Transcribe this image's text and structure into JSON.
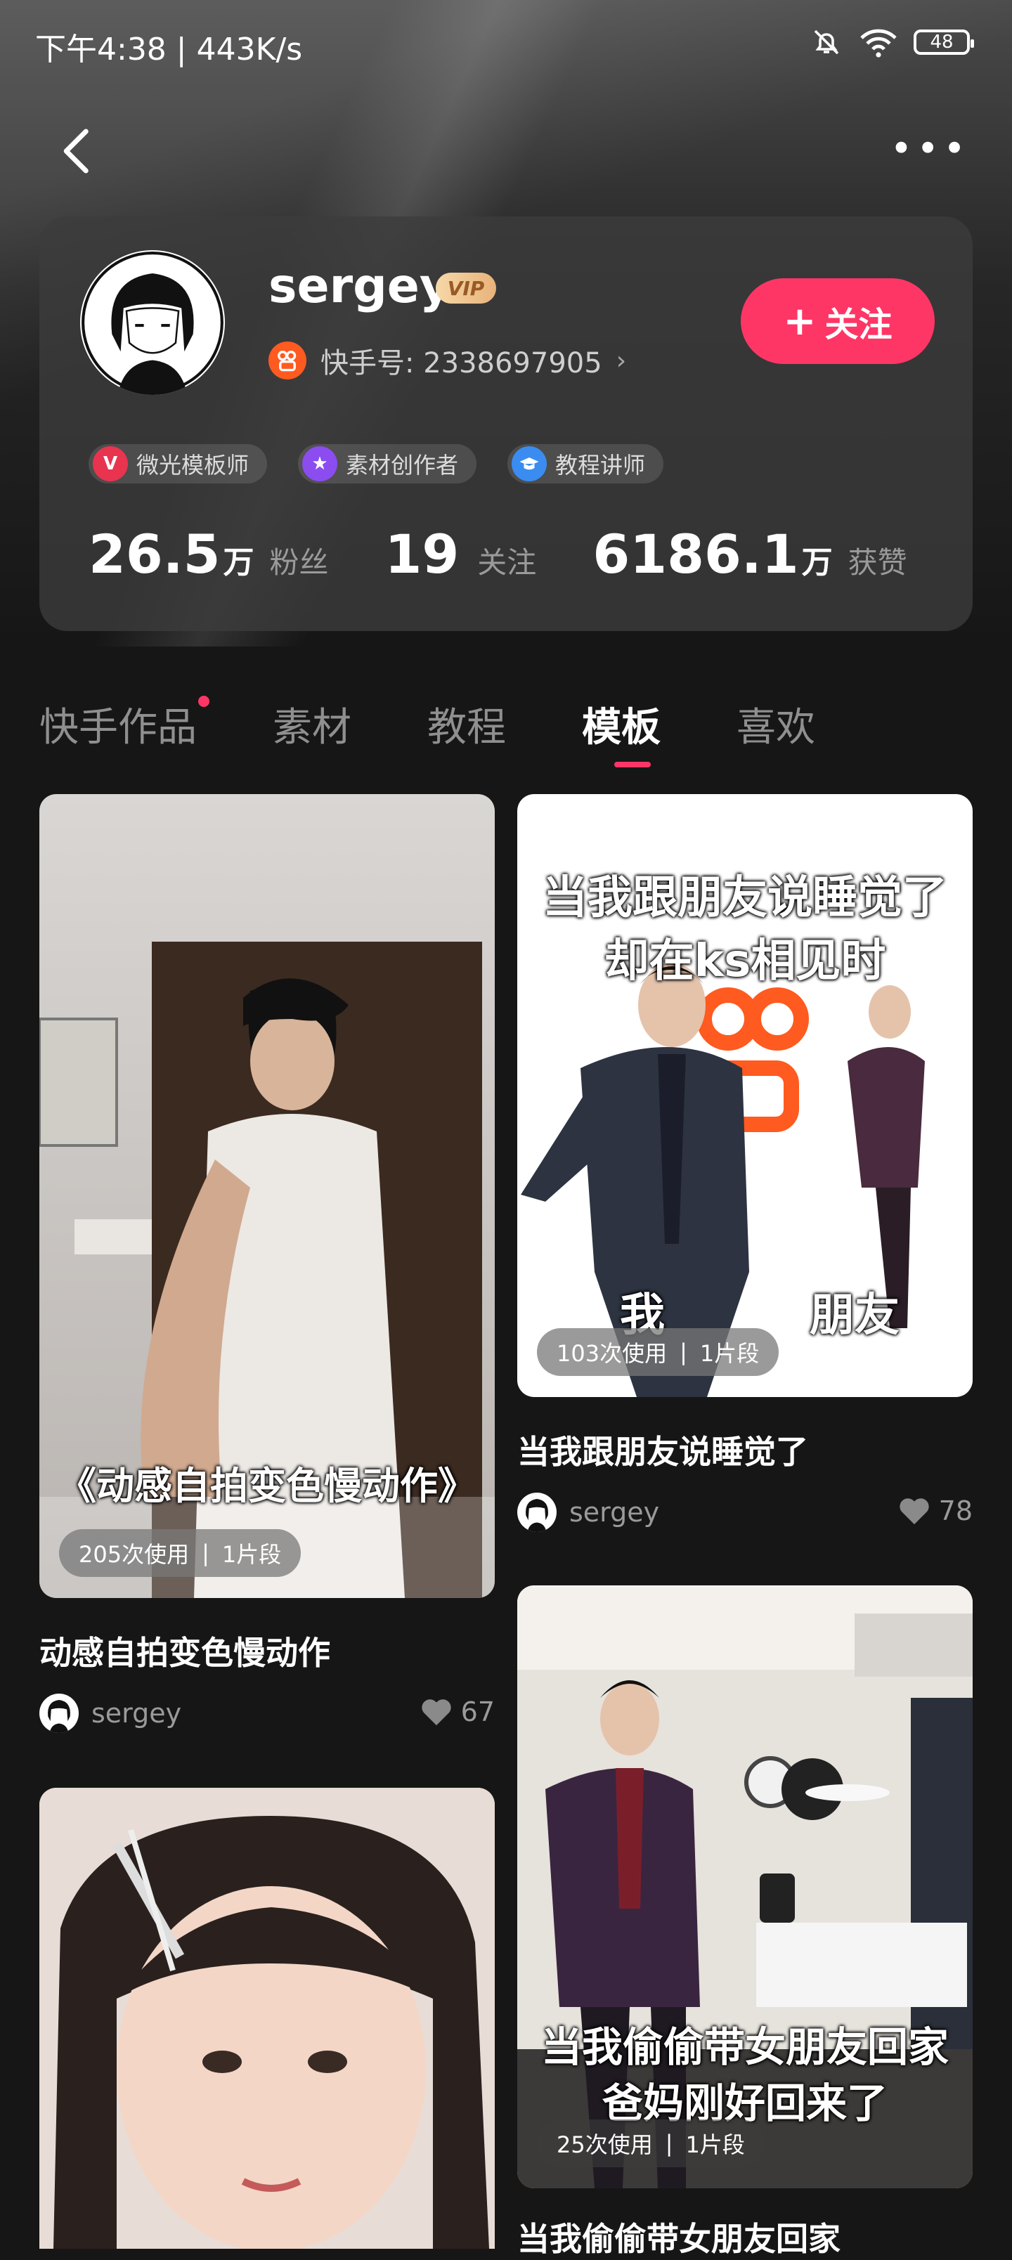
{
  "status": {
    "time_speed": "下午4:38 | 443K/s",
    "battery": "48"
  },
  "profile": {
    "username": "sergey",
    "vip": "VIP",
    "kuaishou_id": "快手号: 2338697905",
    "follow_label": "关注",
    "badges": [
      {
        "label": "微光模板师",
        "icon": "V",
        "color": "#e8344f"
      },
      {
        "label": "素材创作者",
        "icon": "★",
        "color": "#8b4cf0"
      },
      {
        "label": "教程讲师",
        "icon": "🎓",
        "color": "#3a8cf0"
      }
    ],
    "stats": [
      {
        "num": "26.5",
        "unit": "万",
        "label": "粉丝"
      },
      {
        "num": "19",
        "unit": "",
        "label": "关注"
      },
      {
        "num": "6186.1",
        "unit": "万",
        "label": "获赞"
      }
    ]
  },
  "tabs": [
    {
      "label": "快手作品",
      "dot": true
    },
    {
      "label": "素材",
      "dot": false
    },
    {
      "label": "教程",
      "dot": false
    },
    {
      "label": "模板",
      "dot": false,
      "active": true
    },
    {
      "label": "喜欢",
      "dot": false
    }
  ],
  "cards": [
    {
      "overlay": "《动感自拍变色慢动作》",
      "usage": "205次使用",
      "segments": "1片段",
      "title": "动感自拍变色慢动作",
      "author": "sergey",
      "likes": "67"
    },
    {
      "overlay_lines": [
        "当我跟朋友说睡觉了",
        "却在ks相见时"
      ],
      "label_me": "我",
      "label_friend": "朋友",
      "usage": "103次使用",
      "segments": "1片段",
      "title": "当我跟朋友说睡觉了",
      "author": "sergey",
      "likes": "78"
    },
    {
      "overlay_lines": [
        "当我偷偷带女朋友回家",
        "爸妈刚好回来了"
      ],
      "usage": "25次使用",
      "segments": "1片段",
      "title": "当我偷偷带女朋友回家"
    }
  ]
}
